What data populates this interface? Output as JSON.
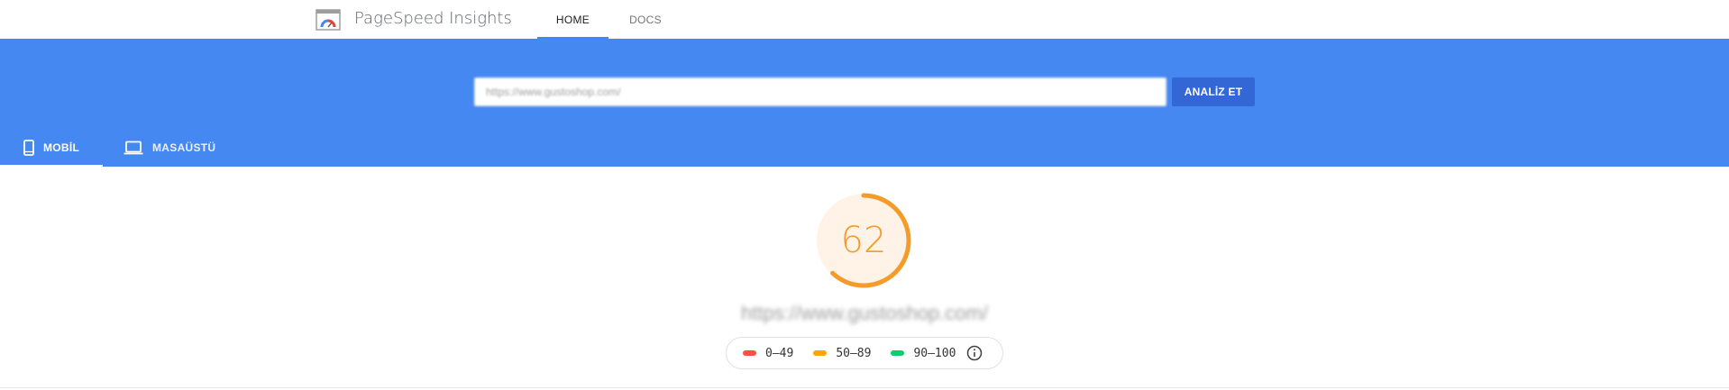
{
  "header": {
    "brand": "PageSpeed Insights",
    "logo_icon": "pagespeed-gauge-icon",
    "tabs": [
      {
        "label": "HOME",
        "active": true
      },
      {
        "label": "DOCS",
        "active": false
      }
    ]
  },
  "search": {
    "value": "https://www.gustoshop.com/",
    "submit_label": "ANALİZ ET"
  },
  "device_tabs": [
    {
      "label": "MOBİL",
      "icon": "smartphone-icon",
      "active": true
    },
    {
      "label": "MASAÜSTÜ",
      "icon": "laptop-icon",
      "active": false
    }
  ],
  "report": {
    "score": "62",
    "score_fraction": 0.62,
    "tested_url": "https://www.gustoshop.com/",
    "legend": [
      {
        "range": "0–49",
        "color": "#ff4e42"
      },
      {
        "range": "50–89",
        "color": "#ffa400"
      },
      {
        "range": "90–100",
        "color": "#0cce6b"
      }
    ],
    "info_icon": "info-icon"
  },
  "colors": {
    "hero_blue": "#4688f1",
    "button_blue": "#3367d6",
    "accent_blue": "#4285f4",
    "score_orange": "#f39c2a",
    "gauge_track": "#fef3e6"
  }
}
